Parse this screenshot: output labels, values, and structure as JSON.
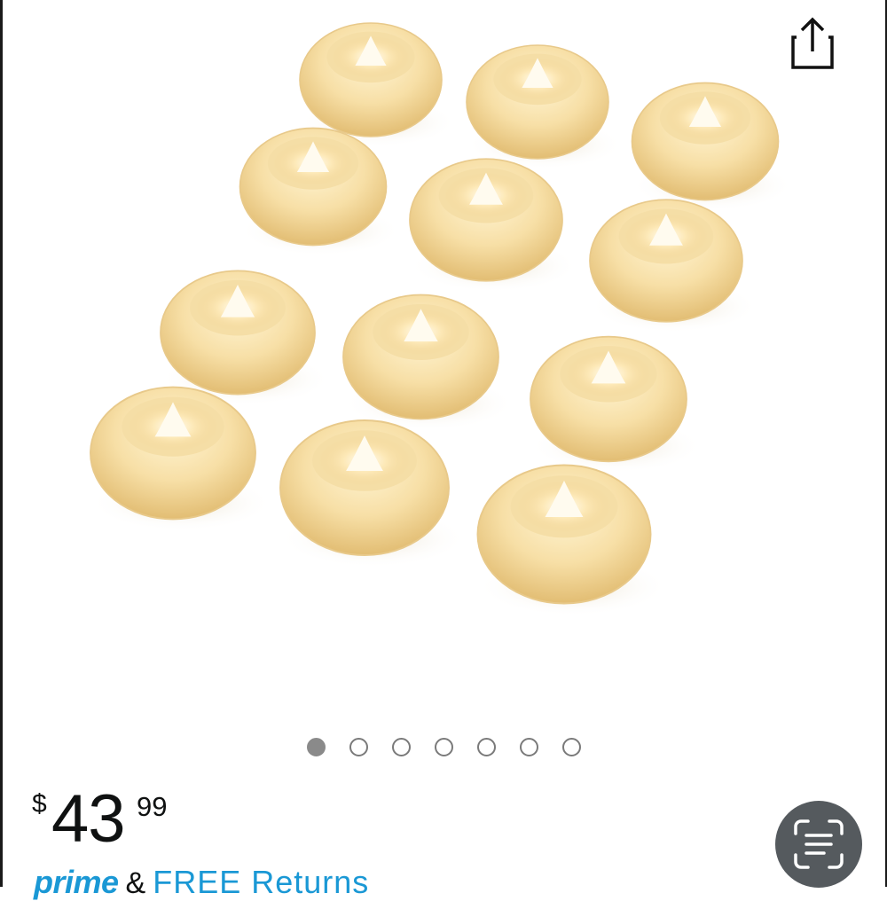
{
  "carousel": {
    "image_count": 7,
    "active_index": 0,
    "dots": [
      {
        "active": true
      },
      {
        "active": false
      },
      {
        "active": false
      },
      {
        "active": false
      },
      {
        "active": false
      },
      {
        "active": false
      },
      {
        "active": false
      }
    ]
  },
  "price": {
    "symbol": "$",
    "whole": "43",
    "fraction": "99"
  },
  "delivery": {
    "prime_label": "prime",
    "ampersand": "&",
    "returns_label": "FREE Returns"
  },
  "colors": {
    "prime_blue": "#1a98d5",
    "text": "#0f1111",
    "lens_button_bg": "#555a5e",
    "dot_active": "#8a8a8a"
  },
  "icons": {
    "share": "share-icon",
    "lens": "scan-lens-icon"
  }
}
